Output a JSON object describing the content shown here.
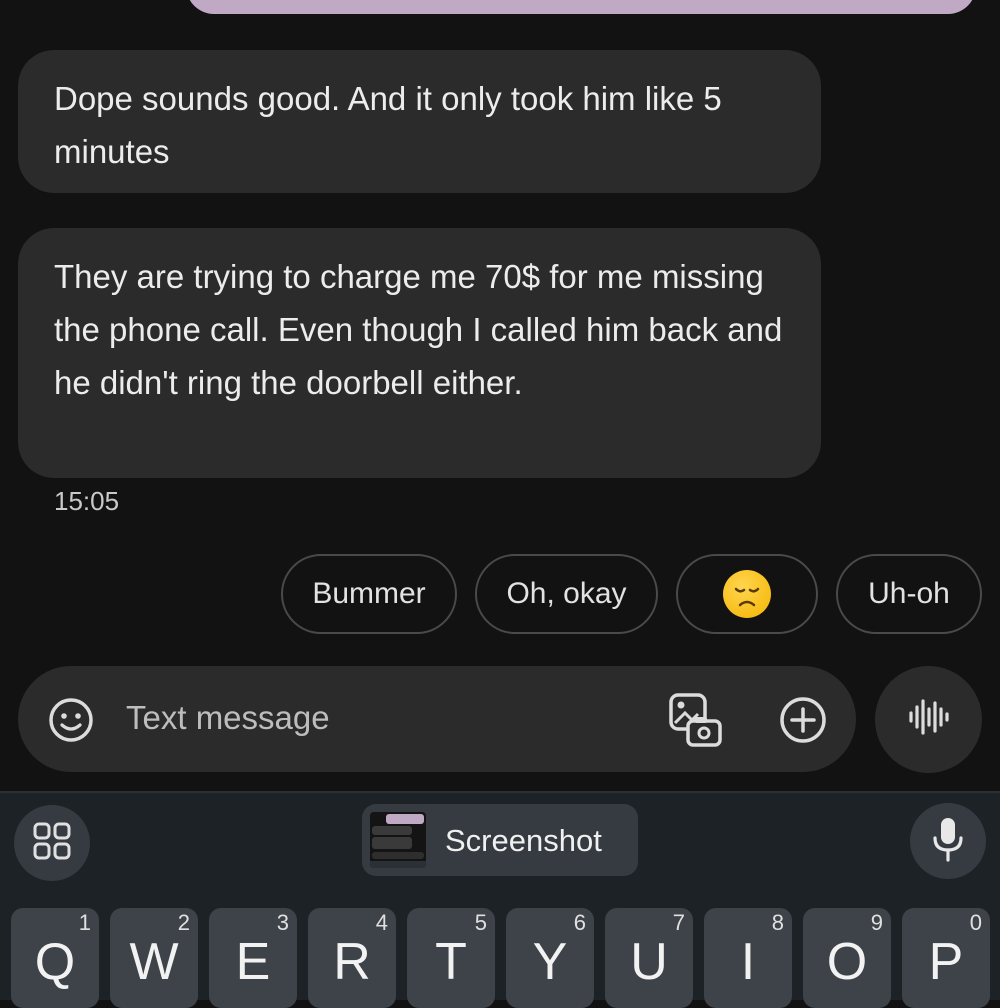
{
  "conversation": {
    "messages": [
      {
        "text": "Dope sounds good. And it only took him like 5 minutes"
      },
      {
        "text": "They are trying to charge me 70$ for me missing the phone call. Even though I called him back and he didn't ring the doorbell either."
      }
    ],
    "timestamp": "15:05"
  },
  "smart_replies": [
    {
      "label": "Bummer"
    },
    {
      "label": "Oh, okay"
    },
    {
      "label": "",
      "icon": "disappointed-face-emoji"
    },
    {
      "label": "Uh-oh"
    }
  ],
  "composer": {
    "placeholder": "Text message",
    "icons": [
      "emoji-icon",
      "gallery-icon",
      "add-icon",
      "voice-waveform-icon"
    ]
  },
  "keyboard": {
    "suggestion_label": "Screenshot",
    "icons": [
      "apps-grid-icon",
      "mic-icon"
    ],
    "row1": [
      {
        "letter": "Q",
        "hint": "1"
      },
      {
        "letter": "W",
        "hint": "2"
      },
      {
        "letter": "E",
        "hint": "3"
      },
      {
        "letter": "R",
        "hint": "4"
      },
      {
        "letter": "T",
        "hint": "5"
      },
      {
        "letter": "Y",
        "hint": "6"
      },
      {
        "letter": "U",
        "hint": "7"
      },
      {
        "letter": "I",
        "hint": "8"
      },
      {
        "letter": "O",
        "hint": "9"
      },
      {
        "letter": "P",
        "hint": "0"
      }
    ]
  },
  "colors": {
    "background": "#121212",
    "received_bubble": "#2b2b2b",
    "sent_bubble": "#c0a9c4",
    "keyboard_bg": "#1d2227",
    "key_bg": "#3d4349"
  }
}
